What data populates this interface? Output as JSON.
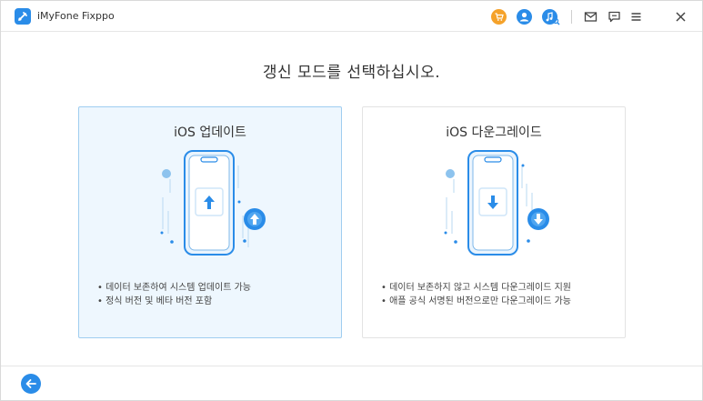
{
  "app": {
    "title": "iMyFone Fixppo",
    "icons": [
      "cart-icon",
      "user-icon",
      "music-search-icon",
      "mail-icon",
      "feedback-icon",
      "menu-icon",
      "close-icon"
    ]
  },
  "main": {
    "heading": "갱신 모드를 선택하십시오."
  },
  "cards": {
    "standard": {
      "title": "iOS 업데이트",
      "features": [
        "• 데이터 보존하여 시스템 업데이트 가능",
        "• 정식 버전 및 베타 버전 포함"
      ],
      "selected": true
    },
    "downgrade": {
      "title": "iOS 다운그레이드",
      "features": [
        "• 데이터 보존하지 않고 시스템 다운그레이드 지원",
        "• 애플 공식 서명된 버전으로만 다운그레이드 가능"
      ],
      "selected": false
    }
  },
  "colors": {
    "accent": "#2a8ce8",
    "cart": "#f5a22a",
    "selected_bg": "#eef7fe",
    "selected_border": "#9fcdf0"
  }
}
